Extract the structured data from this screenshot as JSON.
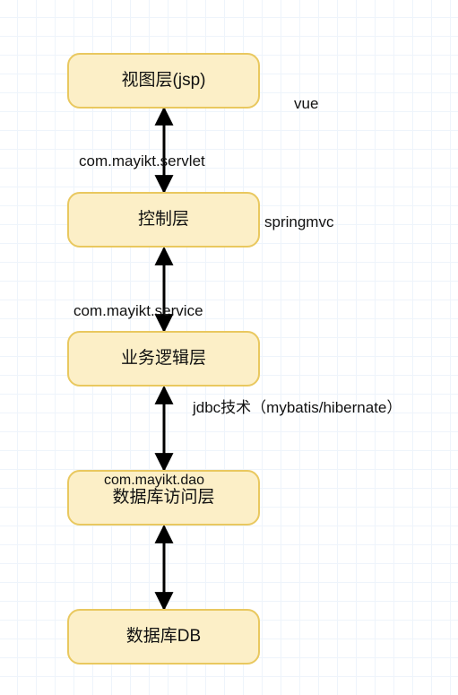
{
  "nodes": {
    "view": {
      "label": "视图层(jsp)"
    },
    "controller": {
      "label": "控制层"
    },
    "service": {
      "label": "业务逻辑层"
    },
    "dao": {
      "label": "数据库访问层"
    },
    "db": {
      "label": "数据库DB"
    }
  },
  "labels": {
    "view_side": "vue",
    "controller_side": "springmvc",
    "servlet_pkg": "com.mayikt.servlet",
    "service_pkg": "com.mayikt.service",
    "dao_pkg": "com.mayikt.dao",
    "jdbc_note": "jdbc技术（mybatis/hibernate）"
  },
  "chart_data": {
    "type": "diagram",
    "title": "",
    "layers": [
      {
        "id": "view",
        "label": "视图层(jsp)",
        "annotation": "vue"
      },
      {
        "id": "controller",
        "label": "控制层",
        "annotation": "springmvc",
        "package": "com.mayikt.servlet"
      },
      {
        "id": "service",
        "label": "业务逻辑层",
        "package": "com.mayikt.service"
      },
      {
        "id": "dao",
        "label": "数据库访问层",
        "package": "com.mayikt.dao",
        "annotation": "jdbc技术（mybatis/hibernate）"
      },
      {
        "id": "db",
        "label": "数据库DB"
      }
    ],
    "edges": [
      {
        "from": "view",
        "to": "controller",
        "bidirectional": true,
        "label": "com.mayikt.servlet"
      },
      {
        "from": "controller",
        "to": "service",
        "bidirectional": true,
        "label": "com.mayikt.service"
      },
      {
        "from": "service",
        "to": "dao",
        "bidirectional": true,
        "label": "jdbc技术（mybatis/hibernate）"
      },
      {
        "from": "dao",
        "to": "db",
        "bidirectional": true
      }
    ]
  }
}
